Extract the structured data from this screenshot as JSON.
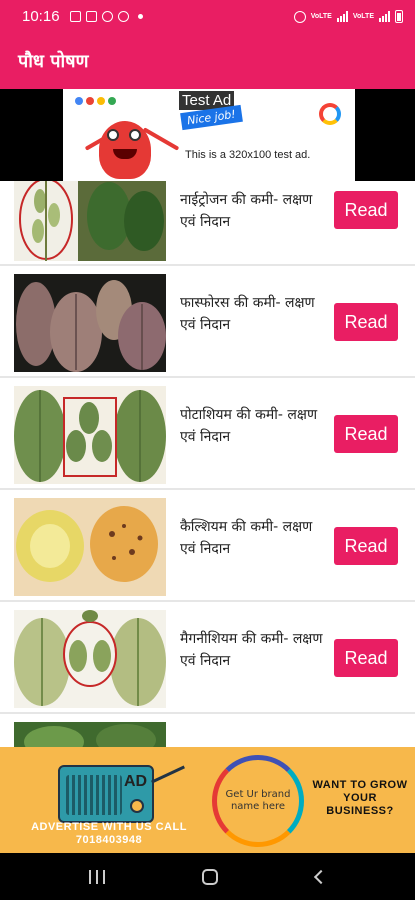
{
  "status_bar": {
    "time": "10:16",
    "network_label_1": "VoLTE",
    "network_label_2": "VoLTE"
  },
  "app_bar": {
    "title": "पौध पोषण"
  },
  "top_ad": {
    "label": "Test Ad",
    "nice_job": "Nice job!",
    "caption": "This is a 320x100 test ad."
  },
  "list": {
    "read_label": "Read",
    "items": [
      {
        "title": "नाईट्रोजन की कमी- लक्षण एवं निदान",
        "thumb_icon": "nitrogen-deficiency-leaf-image"
      },
      {
        "title": "फास्फोरस की कमी- लक्षण एवं निदान",
        "thumb_icon": "phosphorus-deficiency-leaf-image"
      },
      {
        "title": "पोटाशियम की कमी- लक्षण एवं निदान",
        "thumb_icon": "potassium-deficiency-leaf-image"
      },
      {
        "title": "कैल्शियम की कमी- लक्षण एवं निदान",
        "thumb_icon": "calcium-deficiency-apple-image"
      },
      {
        "title": "मैगनीशियम की कमी- लक्षण एवं निदान",
        "thumb_icon": "magnesium-deficiency-leaf-image"
      }
    ]
  },
  "bottom_ad": {
    "radio_label": "AD",
    "advertise_text": "ADVERTISE WITH US CALL 7018403948",
    "brand_text": "Get Ur brand name here",
    "grow_text": "WANT TO GROW YOUR BUSINESS?"
  },
  "colors": {
    "primary": "#e91e63",
    "ad_background": "#f7b84b"
  }
}
